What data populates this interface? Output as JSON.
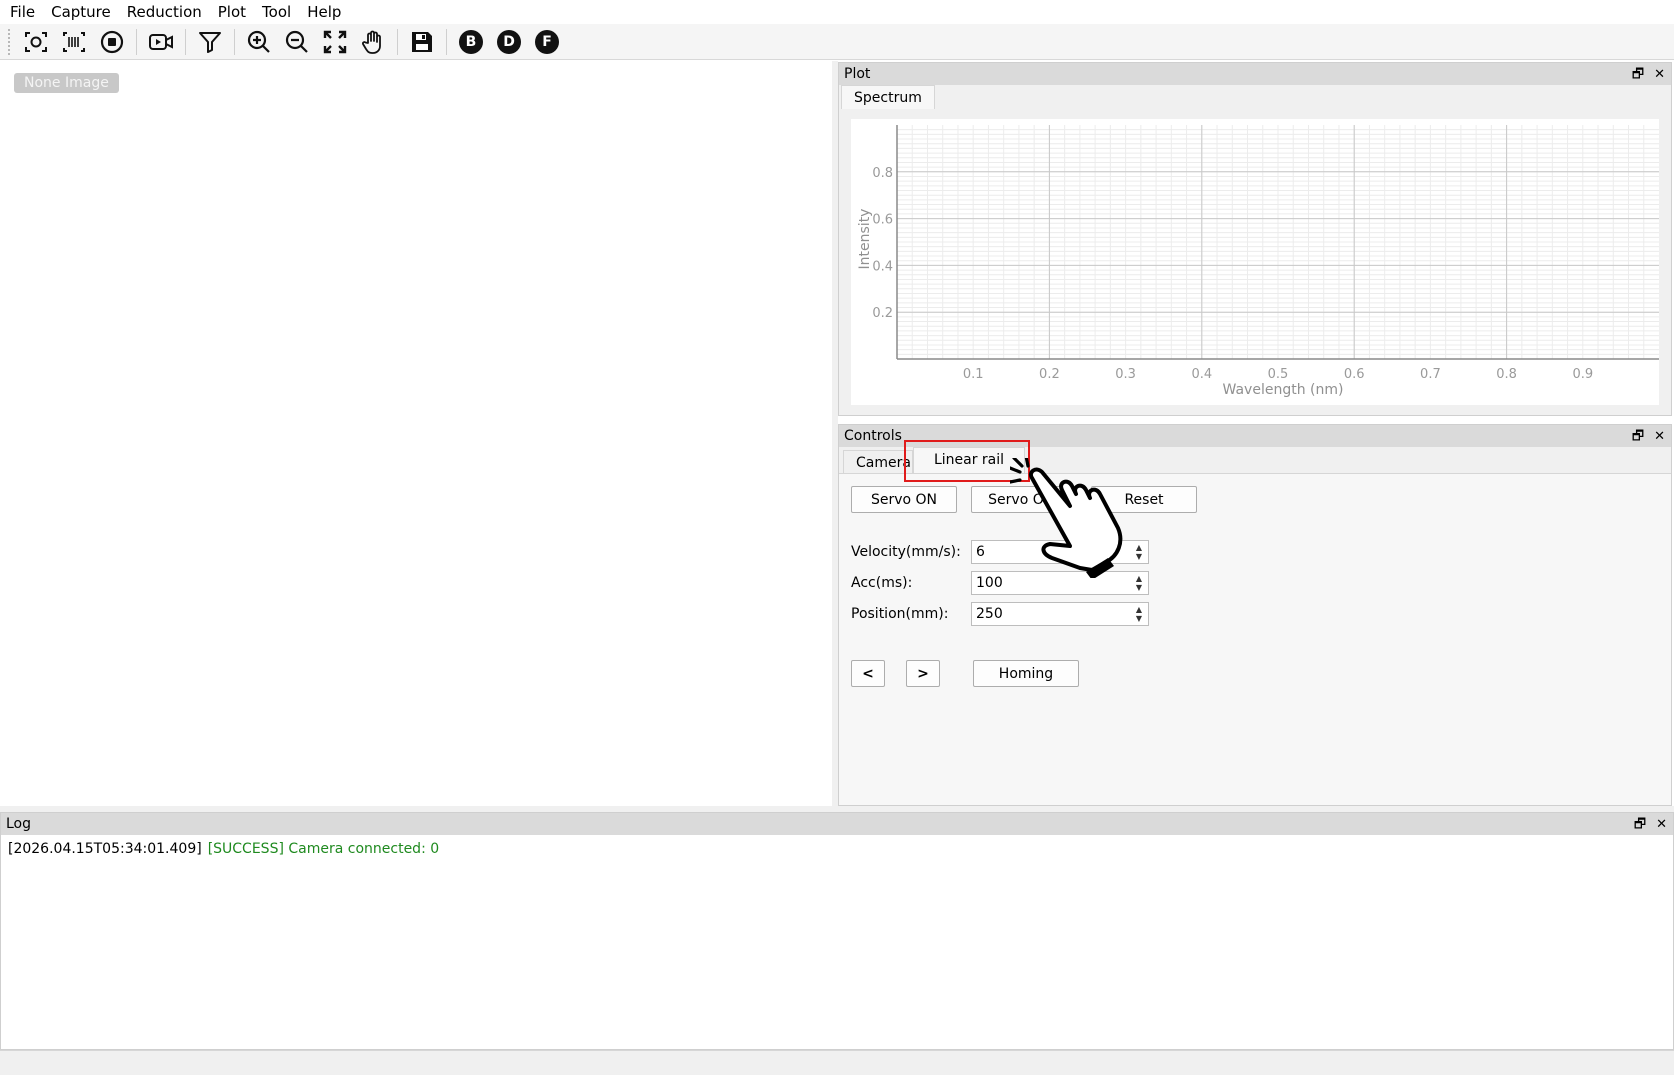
{
  "menu": [
    "File",
    "Capture",
    "Reduction",
    "Plot",
    "Tool",
    "Help"
  ],
  "toolbar": {
    "icons": [
      "capture-icon",
      "barcode-icon",
      "stop-icon",
      "video-icon",
      "filter-icon",
      "zoom-in-icon",
      "zoom-out-icon",
      "fit-screen-icon",
      "hand-icon",
      "save-icon"
    ],
    "letter_b": "B",
    "letter_d": "D",
    "letter_f": "F"
  },
  "image_area": {
    "badge": "None Image"
  },
  "plot_panel": {
    "title": "Plot",
    "tab": "Spectrum"
  },
  "chart_data": {
    "type": "line",
    "title": "",
    "xlabel": "Wavelength (nm)",
    "ylabel": "Intensity",
    "xlim": [
      0,
      1.0
    ],
    "ylim": [
      0,
      1.0
    ],
    "xticks": [
      "0.1",
      "0.2",
      "0.3",
      "0.4",
      "0.5",
      "0.6",
      "0.7",
      "0.8",
      "0.9"
    ],
    "yticks": [
      "0.2",
      "0.4",
      "0.6",
      "0.8"
    ],
    "grid": true,
    "series": []
  },
  "controls_panel": {
    "title": "Controls",
    "tabs": [
      "Camera",
      "Linear rail"
    ],
    "active_tab": "Linear rail",
    "buttons": {
      "servo_on": "Servo ON",
      "servo_off": "Servo OFF",
      "reset": "Reset",
      "prev": "<",
      "next": ">",
      "homing": "Homing"
    },
    "fields": [
      {
        "label": "Velocity(mm/s):",
        "value": "6"
      },
      {
        "label": "Acc(ms):",
        "value": "100"
      },
      {
        "label": "Position(mm):",
        "value": "250"
      }
    ]
  },
  "log_panel": {
    "title": "Log",
    "entries": [
      {
        "time": "[2026.04.15T05:34:01.409]",
        "message": "[SUCCESS] Camera connected: 0"
      }
    ]
  },
  "dock_controls": {
    "float": "🗗",
    "close": "✕"
  },
  "colors": {
    "success": "#1f8a1f",
    "highlight": "#e01b1b"
  }
}
